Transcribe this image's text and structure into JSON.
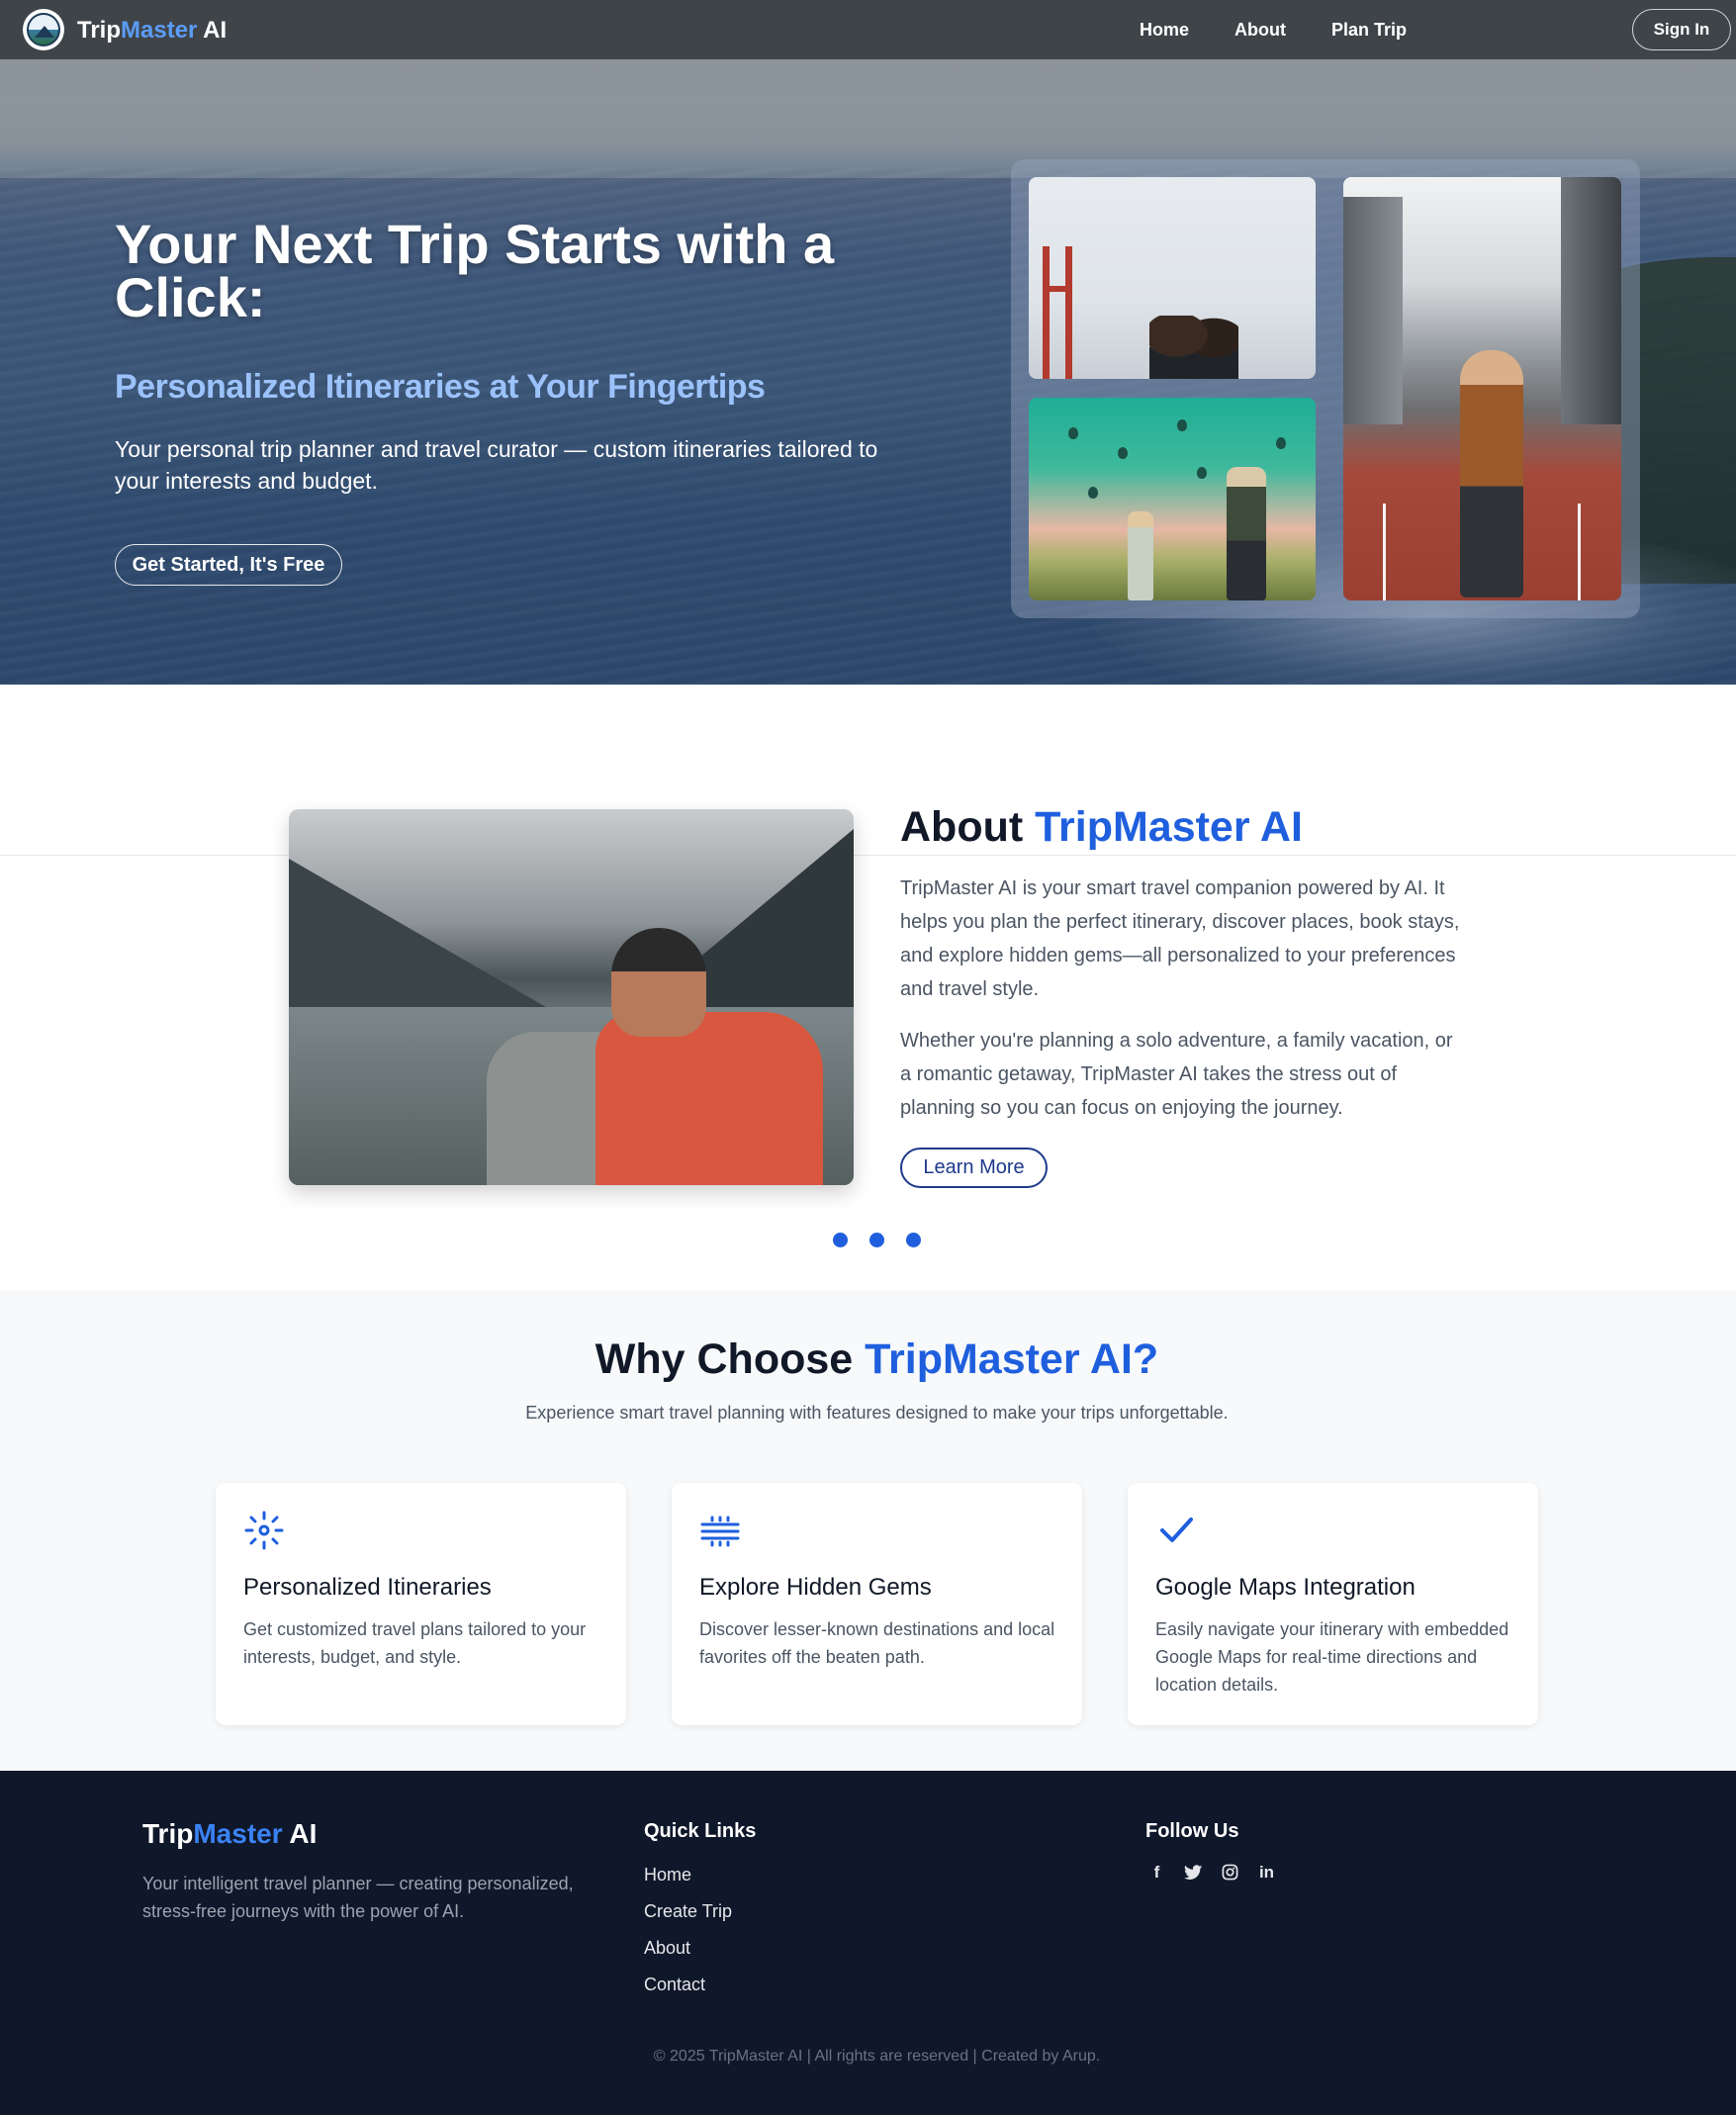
{
  "nav": {
    "brand_a": "Trip",
    "brand_b": "Master",
    "brand_c": " AI",
    "links": [
      "Home",
      "About",
      "Plan Trip"
    ],
    "signin": "Sign In"
  },
  "hero": {
    "title": "Your Next Trip Starts with a Click:",
    "subtitle": "Personalized Itineraries at Your Fingertips",
    "text": "Your personal trip planner and travel curator — custom itineraries tailored to your interests and budget.",
    "cta": "Get Started, It's Free"
  },
  "about": {
    "title_a": "About ",
    "title_b": "TripMaster AI",
    "p1": "TripMaster AI is your smart travel companion powered by AI. It helps you plan the perfect itinerary, discover places, book stays, and explore hidden gems—all personalized to your preferences and travel style.",
    "p2": "Whether you're planning a solo adventure, a family vacation, or a romantic getaway, TripMaster AI takes the stress out of planning so you can focus on enjoying the journey.",
    "cta": "Learn More",
    "carousel_count": 3
  },
  "why": {
    "title_a": "Why Choose ",
    "title_b": "TripMaster AI?",
    "subtitle": "Experience smart travel planning with features designed to make your trips unforgettable.",
    "cards": [
      {
        "icon": "sparkle-icon",
        "title": "Personalized Itineraries",
        "text": "Get customized travel plans tailored to your interests, budget, and style."
      },
      {
        "icon": "lines-icon",
        "title": "Explore Hidden Gems",
        "text": "Discover lesser-known destinations and local favorites off the beaten path."
      },
      {
        "icon": "checkmark-icon",
        "title": "Google Maps Integration",
        "text": "Easily navigate your itinerary with embedded Google Maps for real-time directions and location details."
      }
    ]
  },
  "footer": {
    "brand_a": "Trip",
    "brand_b": "Master",
    "brand_c": " AI",
    "desc": "Your intelligent travel planner — creating personalized, stress-free journeys with the power of AI.",
    "quick_title": "Quick Links",
    "quick_links": [
      "Home",
      "Create Trip",
      "About",
      "Contact"
    ],
    "follow_title": "Follow Us",
    "social": [
      {
        "icon": "facebook-icon",
        "glyph": "f"
      },
      {
        "icon": "twitter-icon",
        "glyph": "🐦"
      },
      {
        "icon": "instagram-icon",
        "glyph": "◎"
      },
      {
        "icon": "linkedin-icon",
        "glyph": "in"
      }
    ],
    "copyright": "© 2025 TripMaster AI | All rights are reserved | Created by Arup."
  },
  "colors": {
    "accent": "#1f5fde",
    "nav_bg": "#3f4449",
    "footer_bg": "#0f172a"
  }
}
